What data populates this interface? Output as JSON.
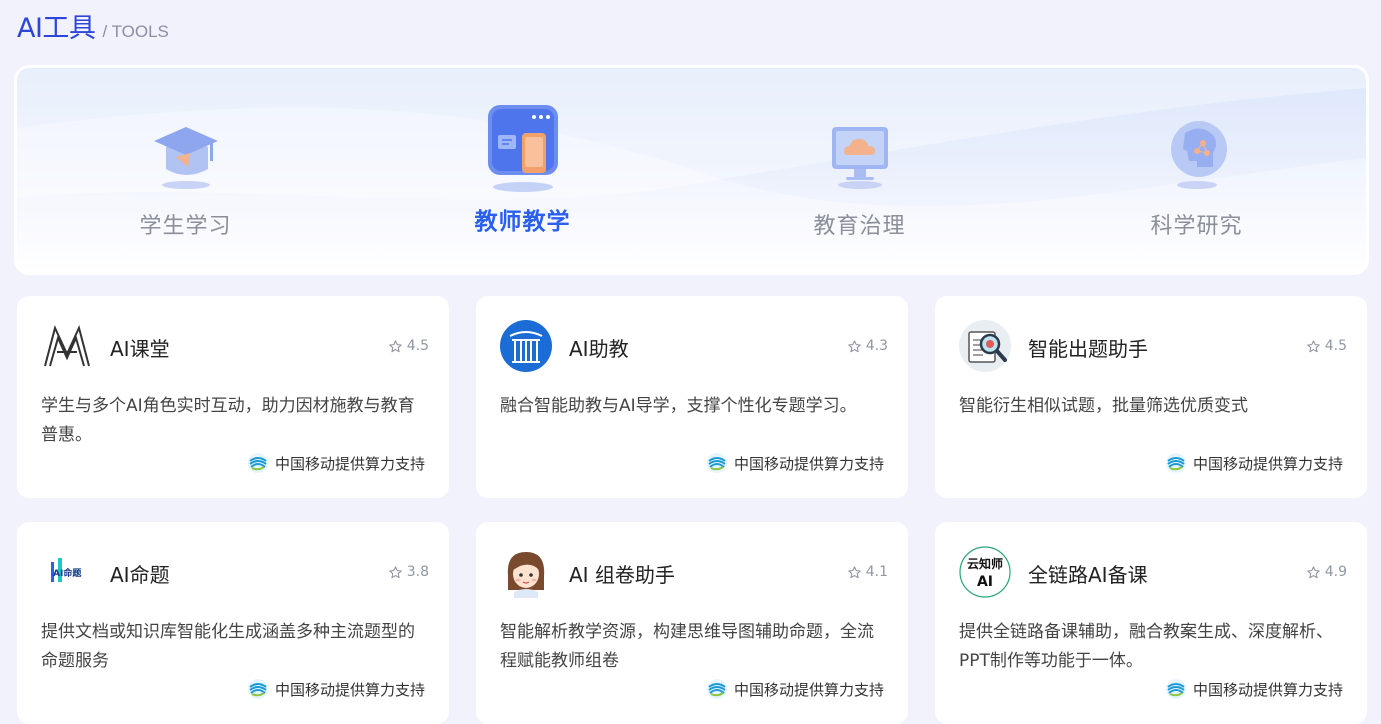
{
  "header": {
    "title": "AI工具",
    "subtitle": "/ TOOLS"
  },
  "categories": [
    {
      "label": "学生学习",
      "icon": "graduation-cap-icon",
      "active": false
    },
    {
      "label": "教师教学",
      "icon": "teaching-screen-icon",
      "active": true
    },
    {
      "label": "教育治理",
      "icon": "cloud-monitor-icon",
      "active": false
    },
    {
      "label": "科学研究",
      "icon": "ai-head-icon",
      "active": false
    }
  ],
  "colors": {
    "accent": "#2a5ff0",
    "title": "#2c46d9",
    "background": "#f1f2fc"
  },
  "tools": [
    {
      "name": "AI课堂",
      "rating": "4.5",
      "desc": "学生与多个AI角色实时互动，助力因材施教与教育普惠。",
      "support": "中国移动提供算力支持",
      "logo": "ai-classroom-logo"
    },
    {
      "name": "AI助教",
      "rating": "4.3",
      "desc": "融合智能助教与AI导学，支撑个性化专题学习。",
      "support": "中国移动提供算力支持",
      "logo": "ai-assistant-logo"
    },
    {
      "name": "智能出题助手",
      "rating": "4.5",
      "desc": "智能衍生相似试题，批量筛选优质变式",
      "support": "中国移动提供算力支持",
      "logo": "magnifier-doc-logo"
    },
    {
      "name": "AI命题",
      "rating": "3.8",
      "desc": "提供文档或知识库智能化生成涵盖多种主流题型的命题服务",
      "support": "中国移动提供算力支持",
      "logo": "ai-question-logo",
      "logo_text": "AI命题"
    },
    {
      "name": "AI 组卷助手",
      "rating": "4.1",
      "desc": "智能解析教学资源，构建思维导图辅助命题，全流程赋能教师组卷",
      "support": "中国移动提供算力支持",
      "logo": "teacher-avatar-logo"
    },
    {
      "name": "全链路AI备课",
      "rating": "4.9",
      "desc": "提供全链路备课辅助，融合教案生成、深度解析、PPT制作等功能于一体。",
      "support": "中国移动提供算力支持",
      "logo": "yunzhishi-logo",
      "logo_text_top": "云知师",
      "logo_text_bottom": "AI"
    }
  ]
}
